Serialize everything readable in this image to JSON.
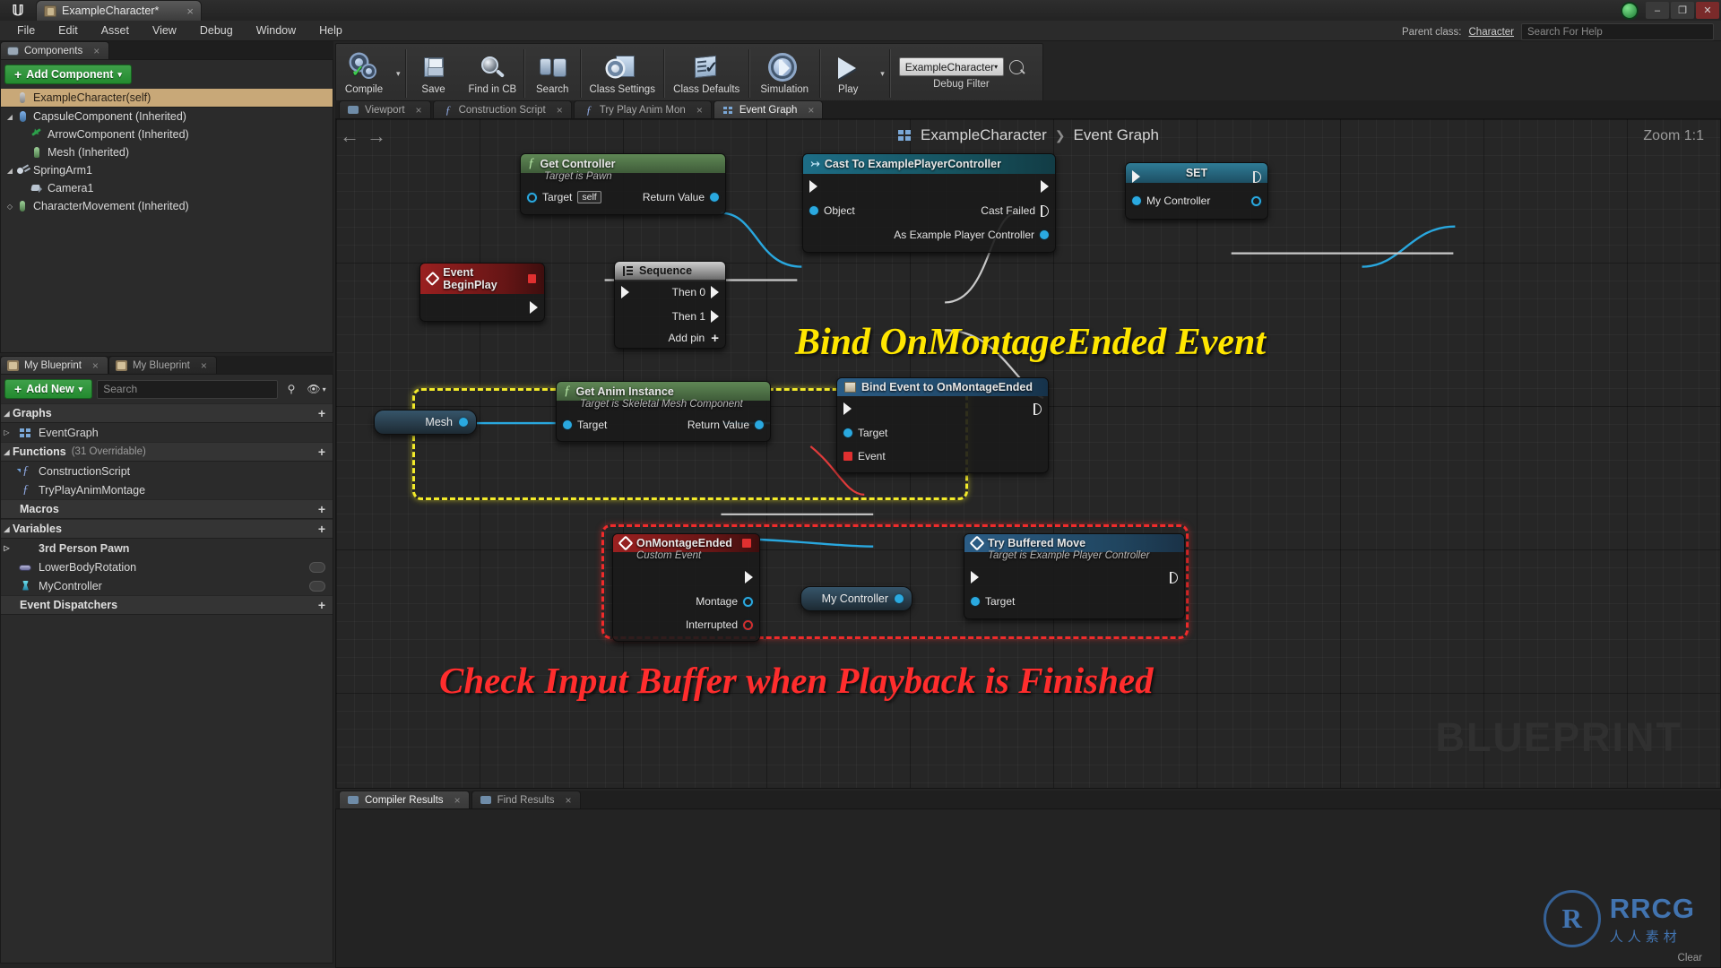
{
  "window": {
    "logo": "unreal-logo",
    "tab_title": "ExampleCharacter*",
    "tab_close": "×",
    "minimize": "–",
    "maximize": "❐",
    "close": "✕"
  },
  "menubar": {
    "items": [
      "File",
      "Edit",
      "Asset",
      "View",
      "Debug",
      "Window",
      "Help"
    ]
  },
  "header_right": {
    "parent_class_label": "Parent class:",
    "parent_class_value": "Character",
    "search_placeholder": "Search For Help"
  },
  "components_panel": {
    "tab_label": "Components",
    "tab_close": "×",
    "add_component_label": "Add Component",
    "add_component_plus": "+",
    "add_component_caret": "▾",
    "items": [
      {
        "label": "ExampleCharacter(self)",
        "icon": "self-icon",
        "indent": 0,
        "selected": true,
        "twisty": ""
      },
      {
        "label": "CapsuleComponent (Inherited)",
        "icon": "capsule-icon",
        "indent": 0,
        "selected": false,
        "twisty": "◢"
      },
      {
        "label": "ArrowComponent (Inherited)",
        "icon": "arrow-icon",
        "indent": 1,
        "selected": false,
        "twisty": ""
      },
      {
        "label": "Mesh (Inherited)",
        "icon": "mesh-icon",
        "indent": 1,
        "selected": false,
        "twisty": ""
      },
      {
        "label": "SpringArm1",
        "icon": "springarm-icon",
        "indent": 0,
        "selected": false,
        "twisty": "◢"
      },
      {
        "label": "Camera1",
        "icon": "camera-icon",
        "indent": 1,
        "selected": false,
        "twisty": ""
      },
      {
        "label": "CharacterMovement (Inherited)",
        "icon": "charactermovement-icon",
        "indent": 0,
        "selected": false,
        "twisty": "◇"
      }
    ]
  },
  "myblueprint_panel": {
    "tab_label_active": "My Blueprint",
    "tab_label_inactive": "My Blueprint",
    "tab_close": "×",
    "add_new_label": "Add New",
    "add_new_plus": "+",
    "add_new_caret": "▾",
    "search_placeholder": "Search",
    "search_icon": "search-icon",
    "eye_icon": "eye-icon",
    "eye_caret": "▾",
    "sections": [
      {
        "name": "Graphs",
        "plus": "+",
        "twisty": "◢",
        "count": "",
        "items": [
          {
            "label": "EventGraph",
            "icon": "graph-icon",
            "twisty": "▷"
          }
        ]
      },
      {
        "name": "Functions",
        "plus": "+",
        "twisty": "◢",
        "count": "(31 Overridable)",
        "items": [
          {
            "label": "ConstructionScript",
            "icon": "function-override-icon",
            "twisty": ""
          },
          {
            "label": "TryPlayAnimMontage",
            "icon": "function-icon",
            "twisty": ""
          }
        ]
      },
      {
        "name": "Macros",
        "plus": "+",
        "twisty": "",
        "count": "",
        "items": []
      },
      {
        "name": "Variables",
        "plus": "+",
        "twisty": "◢",
        "count": "",
        "items": [
          {
            "label": "3rd Person Pawn",
            "icon": "category-icon",
            "twisty": "▷",
            "bold": true
          },
          {
            "label": "LowerBodyRotation",
            "icon": "bool-variable-icon",
            "twisty": "",
            "toggle": true
          },
          {
            "label": "MyController",
            "icon": "object-variable-icon",
            "twisty": "",
            "toggle": true
          }
        ]
      },
      {
        "name": "Event Dispatchers",
        "plus": "+",
        "twisty": "",
        "count": "",
        "items": []
      }
    ]
  },
  "toolbar": {
    "buttons": [
      {
        "label": "Compile",
        "icon": "compile-icon",
        "has_caret": true
      },
      {
        "label": "Save",
        "icon": "save-icon",
        "has_caret": false
      },
      {
        "label": "Find in CB",
        "icon": "find-in-content-browser-icon",
        "has_caret": false
      },
      {
        "label": "Search",
        "icon": "search-binoculars-icon",
        "has_caret": false
      },
      {
        "label": "Class Settings",
        "icon": "class-settings-icon",
        "has_caret": false
      },
      {
        "label": "Class Defaults",
        "icon": "class-defaults-icon",
        "has_caret": false
      },
      {
        "label": "Simulation",
        "icon": "simulation-icon",
        "has_caret": false
      },
      {
        "label": "Play",
        "icon": "play-icon",
        "has_caret": true
      }
    ],
    "debug_filter": {
      "value": "ExampleCharacter",
      "caret": "▾",
      "search_icon": "search-icon",
      "label": "Debug Filter"
    }
  },
  "graph_tabs": [
    {
      "label": "Viewport",
      "icon": "viewport-icon",
      "active": false,
      "close": "×"
    },
    {
      "label": "Construction Script",
      "icon": "construction-script-icon",
      "active": false,
      "close": "×"
    },
    {
      "label": "Try Play Anim Mon",
      "icon": "function-icon",
      "active": false,
      "close": "×"
    },
    {
      "label": "Event Graph",
      "icon": "event-graph-icon",
      "active": true,
      "close": "×"
    }
  ],
  "graph": {
    "nav_back": "←",
    "nav_forward": "→",
    "breadcrumb_icon": "event-graph-icon",
    "breadcrumb_root": "ExampleCharacter",
    "breadcrumb_sep": "❯",
    "breadcrumb_leaf": "Event Graph",
    "zoom_label": "Zoom 1:1",
    "watermark": "BLUEPRINT",
    "annotations": [
      {
        "text": "Bind OnMontageEnded Event",
        "color": "#ffe600"
      },
      {
        "text": "Check Input Buffer when Playback is Finished",
        "color": "#ff2d2d"
      }
    ],
    "nodes": {
      "get_controller": {
        "title": "Get Controller",
        "subtitle": "Target is Pawn",
        "icon": "function-icon",
        "in_pin": "Target",
        "in_value": "self",
        "out_pin": "Return Value"
      },
      "cast_to_example_player_controller": {
        "title": "Cast To ExamplePlayerController",
        "icon": "cast-icon",
        "in_object": "Object",
        "out_cast_failed": "Cast Failed",
        "out_as": "As Example Player Controller"
      },
      "set_my_controller": {
        "title": "SET",
        "pin": "My Controller"
      },
      "event_begin_play": {
        "title": "Event BeginPlay",
        "icon": "event-icon"
      },
      "sequence": {
        "title": "Sequence",
        "icon": "sequence-icon",
        "then_0": "Then 0",
        "then_1": "Then 1",
        "add_pin": "Add pin",
        "add_pin_plus": "+"
      },
      "mesh_var": {
        "label": "Mesh"
      },
      "get_anim_instance": {
        "title": "Get Anim Instance",
        "subtitle": "Target is Skeletal Mesh Component",
        "icon": "function-icon",
        "in_pin": "Target",
        "out_pin": "Return Value"
      },
      "bind_event": {
        "title": "Bind Event to OnMontageEnded",
        "icon": "bind-event-icon",
        "pin_target": "Target",
        "pin_event": "Event"
      },
      "on_montage_ended": {
        "title": "OnMontageEnded",
        "subtitle": "Custom Event",
        "icon": "event-icon",
        "out_montage": "Montage",
        "out_interrupted": "Interrupted"
      },
      "my_controller_var": {
        "label": "My Controller"
      },
      "try_buffered_move": {
        "title": "Try Buffered Move",
        "subtitle": "Target is Example Player Controller",
        "icon": "event-icon",
        "pin_target": "Target"
      }
    }
  },
  "bottom_tabs": [
    {
      "label": "Compiler Results",
      "icon": "compiler-results-icon",
      "active": true,
      "close": "×"
    },
    {
      "label": "Find Results",
      "icon": "find-results-icon",
      "active": false,
      "close": "×"
    }
  ],
  "watermark_brand": {
    "monogram": "R",
    "line1": "RRCG",
    "line2": "人人素材"
  },
  "bottom_status": {
    "clear_label": "Clear"
  }
}
